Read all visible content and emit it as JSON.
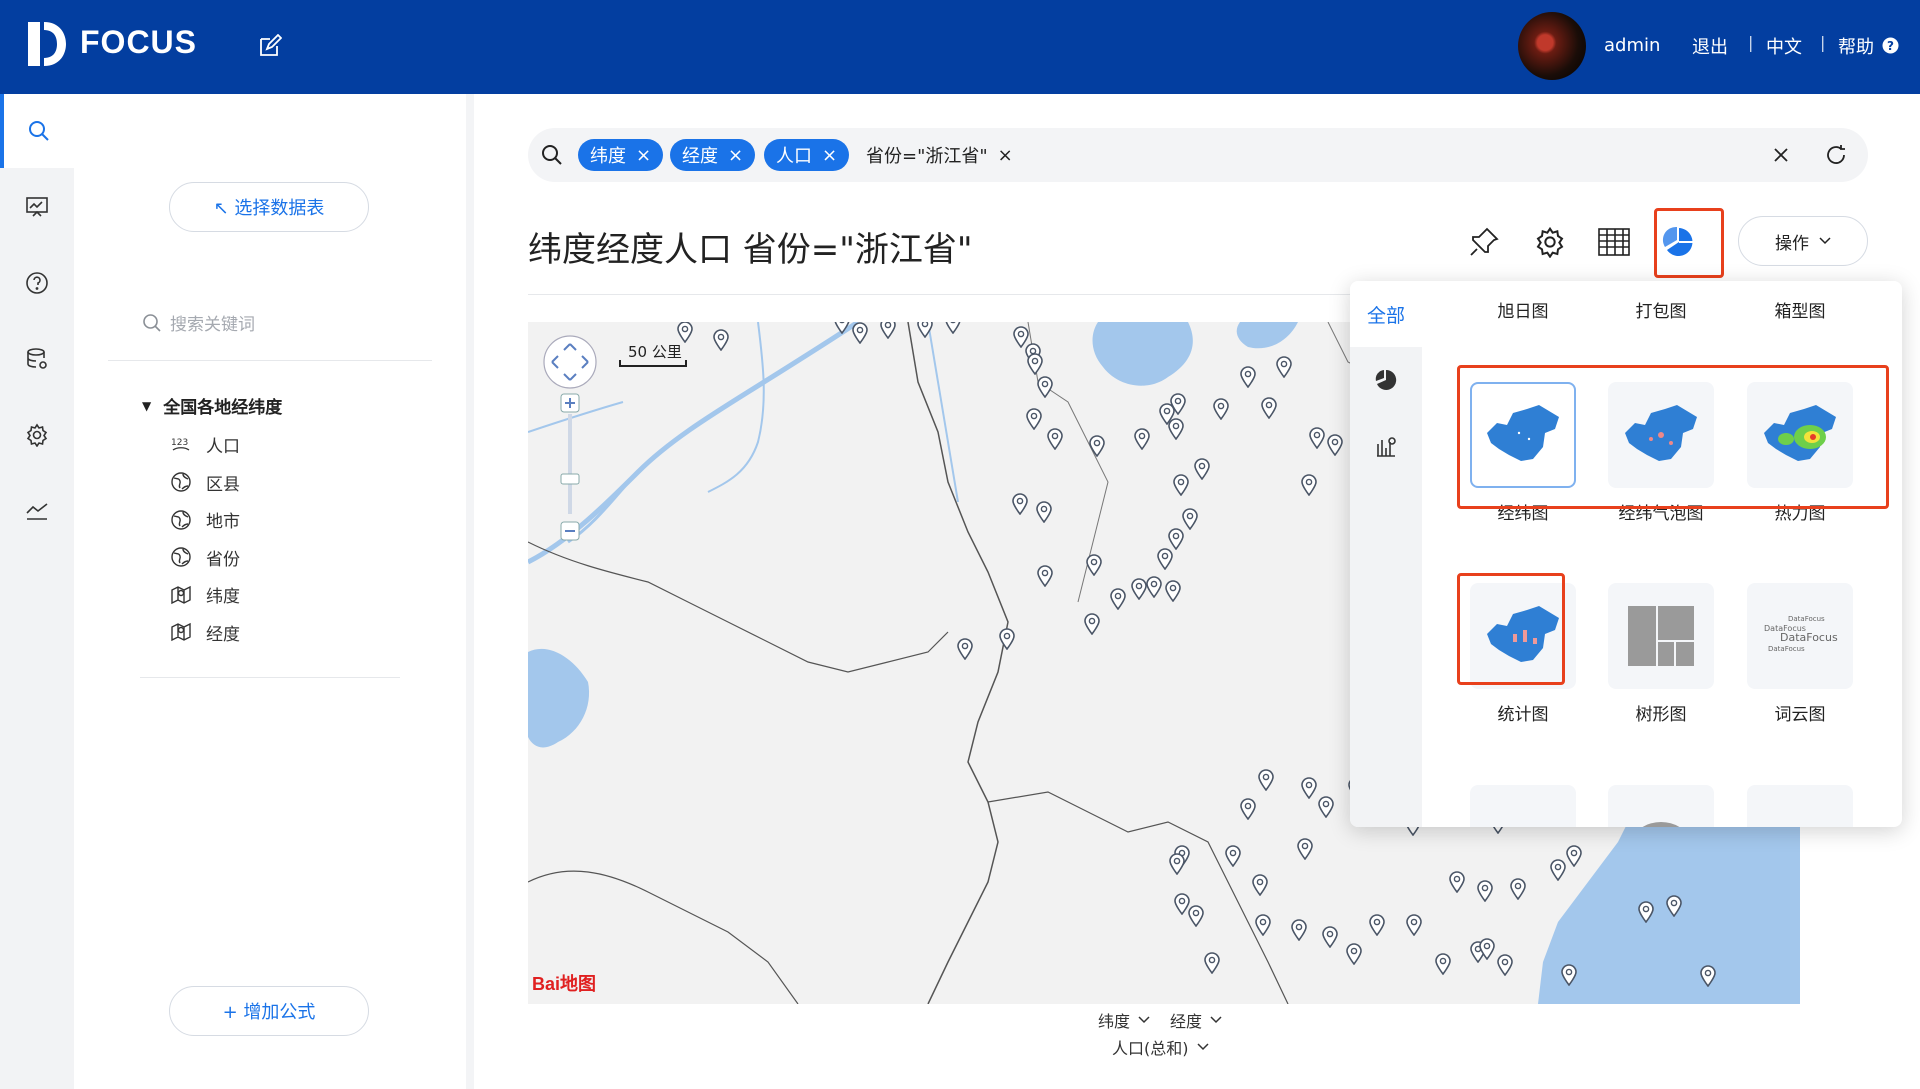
{
  "header": {
    "logo_text": "FOCUS",
    "user": "admin",
    "logout": "退出",
    "language": "中文",
    "help": "帮助",
    "sep": "|"
  },
  "sidebar": {
    "select_table": "↖ 选择数据表",
    "search_placeholder": "搜索关键词",
    "table_name": "全国各地经纬度",
    "fields": [
      {
        "name": "人口",
        "icon": "number-icon"
      },
      {
        "name": "区县",
        "icon": "globe-icon"
      },
      {
        "name": "地市",
        "icon": "globe-icon"
      },
      {
        "name": "省份",
        "icon": "globe-icon"
      },
      {
        "name": "纬度",
        "icon": "map-icon"
      },
      {
        "name": "经度",
        "icon": "map-icon"
      }
    ],
    "add_formula": "+ 增加公式"
  },
  "search": {
    "tokens": [
      "纬度",
      "经度",
      "人口"
    ],
    "filter": "省份=\"浙江省\""
  },
  "main": {
    "title": "纬度经度人口 省份=\"浙江省\"",
    "ops_label": "操作"
  },
  "map": {
    "scale_label": "50 公里",
    "baidu_logo": "Bai地图",
    "x_axis": "纬度",
    "y_axis": "经度",
    "measure": "人口(总和)"
  },
  "chart_picker": {
    "tab_all": "全部",
    "top_row": [
      "旭日图",
      "打包图",
      "箱型图"
    ],
    "row1": [
      "经纬图",
      "经纬气泡图",
      "热力图"
    ],
    "row2": [
      "统计图",
      "树形图",
      "词云图"
    ]
  },
  "colors": {
    "brand_blue": "#033ea0",
    "accent": "#1a73e8",
    "highlight_red": "#e8401c",
    "water": "#a3c7ec"
  }
}
